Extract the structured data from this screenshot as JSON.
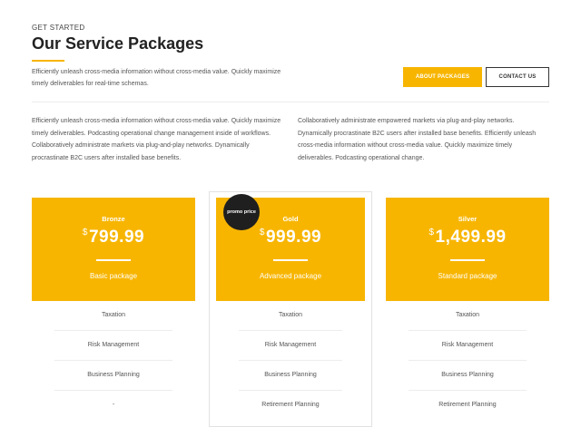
{
  "header": {
    "eyebrow": "GET STARTED",
    "title": "Our Service Packages",
    "intro": "Efficiently unleash cross-media information without cross-media value. Quickly maximize timely deliverables for real-time schemas."
  },
  "buttons": {
    "about": "ABOUT PACKAGES",
    "contact": "CONTACT US"
  },
  "columns": {
    "left": "Efficiently unleash cross-media information without cross-media value. Quickly maximize timely deliverables. Podcasting operational change management inside of workflows. Collaboratively administrate markets via plug-and-play networks. Dynamically procrastinate B2C users after installed base benefits.",
    "right": "Collaboratively administrate empowered markets via plug-and-play networks. Dynamically procrastinate B2C users after installed base benefits. Efficiently unleash cross-media information without cross-media value. Quickly maximize timely deliverables. Podcasting operational change."
  },
  "badge": "promo price",
  "packages": [
    {
      "name": "Bronze",
      "currency": "$",
      "amount": "799.99",
      "subtitle": "Basic package",
      "features": [
        "Taxation",
        "Risk Management",
        "Business Planning",
        "-"
      ]
    },
    {
      "name": "Gold",
      "currency": "$",
      "amount": "999.99",
      "subtitle": "Advanced package",
      "features": [
        "Taxation",
        "Risk Management",
        "Business Planning",
        "Retirement Planning"
      ]
    },
    {
      "name": "Silver",
      "currency": "$",
      "amount": "1,499.99",
      "subtitle": "Standard package",
      "features": [
        "Taxation",
        "Risk Management",
        "Business Planning",
        "Retirement Planning"
      ]
    }
  ],
  "colors": {
    "accent": "#f7b500",
    "badge": "#1f1f1f"
  }
}
